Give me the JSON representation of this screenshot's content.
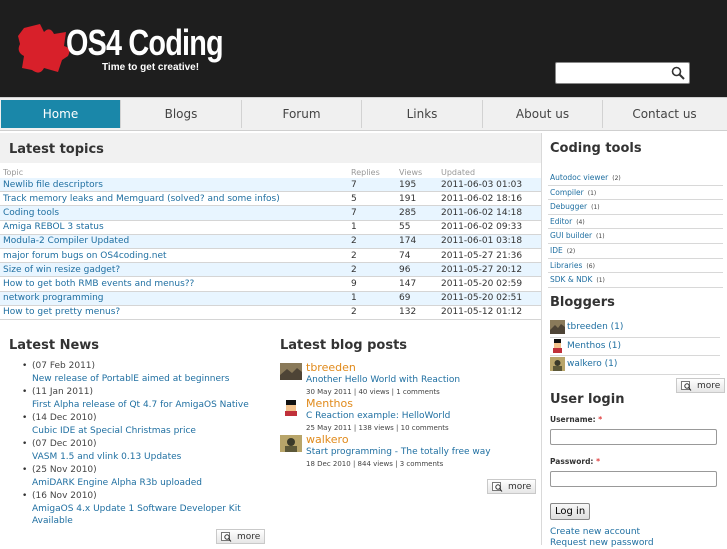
{
  "brand": {
    "name": "OS4 Coding",
    "slogan": "Time to get creative!"
  },
  "search": {
    "value": "",
    "placeholder": ""
  },
  "nav": [
    {
      "label": "Home"
    },
    {
      "label": "Blogs"
    },
    {
      "label": "Forum"
    },
    {
      "label": "Links"
    },
    {
      "label": "About us"
    },
    {
      "label": "Contact us"
    }
  ],
  "topics": {
    "title": "Latest topics",
    "headers": {
      "topic": "Topic",
      "replies": "Replies",
      "views": "Views",
      "updated": "Updated"
    },
    "rows": [
      {
        "topic": "Newlib file descriptors",
        "replies": "7",
        "views": "195",
        "updated": "2011-06-03 01:03"
      },
      {
        "topic": "Track memory leaks and Memguard (solved? and some infos)",
        "replies": "5",
        "views": "191",
        "updated": "2011-06-02 18:16"
      },
      {
        "topic": "Coding tools",
        "replies": "7",
        "views": "285",
        "updated": "2011-06-02 14:18"
      },
      {
        "topic": "Amiga REBOL 3 status",
        "replies": "1",
        "views": "55",
        "updated": "2011-06-02 09:33"
      },
      {
        "topic": "Modula-2 Compiler Updated",
        "replies": "2",
        "views": "174",
        "updated": "2011-06-01 03:18"
      },
      {
        "topic": "major forum bugs on OS4coding.net",
        "replies": "2",
        "views": "74",
        "updated": "2011-05-27 21:36"
      },
      {
        "topic": "Size of win resize gadget?",
        "replies": "2",
        "views": "96",
        "updated": "2011-05-27 20:12"
      },
      {
        "topic": "How to get both RMB events and menus??",
        "replies": "9",
        "views": "147",
        "updated": "2011-05-20 02:59"
      },
      {
        "topic": "network programming",
        "replies": "1",
        "views": "69",
        "updated": "2011-05-20 02:51"
      },
      {
        "topic": "How to get pretty menus?",
        "replies": "2",
        "views": "132",
        "updated": "2011-05-12 01:12"
      }
    ]
  },
  "news": {
    "title": "Latest News",
    "items": [
      {
        "date": "(07 Feb 2011)",
        "link": "New release of PortablE aimed at beginners"
      },
      {
        "date": "(11 Jan 2011)",
        "link": "First Alpha release of Qt 4.7 for AmigaOS Native"
      },
      {
        "date": "(14 Dec 2010)",
        "link": "Cubic IDE at Special Christmas price"
      },
      {
        "date": "(07 Dec 2010)",
        "link": "VASM 1.5 and vlink 0.13 Updates"
      },
      {
        "date": "(25 Nov 2010)",
        "link": "AmiDARK Engine Alpha R3b uploaded"
      },
      {
        "date": "(16 Nov 2010)",
        "link": "AmigaOS 4.x Update 1 Software Developer Kit Available"
      }
    ],
    "more": "more"
  },
  "blog": {
    "title": "Latest blog posts",
    "posts": [
      {
        "author": "tbreeden",
        "title": "Another Hello World with Reaction",
        "date": "30 May 2011",
        "views": "40 views",
        "comments": "1 comments"
      },
      {
        "author": "Menthos",
        "title": "C Reaction example: HelloWorld",
        "date": "25 May 2011",
        "views": "138 views",
        "comments": "10 comments"
      },
      {
        "author": "walkero",
        "title": "Start programming - The totally free way",
        "date": "18 Dec 2010",
        "views": "844 views",
        "comments": "3 comments"
      }
    ],
    "more": "more"
  },
  "sidebar": {
    "tools_title": "Coding tools",
    "tools": [
      {
        "label": "Autodoc viewer",
        "count": "(2)"
      },
      {
        "label": "Compiler",
        "count": "(1)"
      },
      {
        "label": "Debugger",
        "count": "(1)"
      },
      {
        "label": "Editor",
        "count": "(4)"
      },
      {
        "label": "GUI builder",
        "count": "(1)"
      },
      {
        "label": "IDE",
        "count": "(2)"
      },
      {
        "label": "Libraries",
        "count": "(6)"
      },
      {
        "label": "SDK & NDK",
        "count": "(1)"
      }
    ],
    "bloggers_title": "Bloggers",
    "bloggers": [
      {
        "label": "tbreeden (1)"
      },
      {
        "label": "Menthos (1)"
      },
      {
        "label": "walkero (1)"
      }
    ],
    "bloggers_more": "more",
    "login": {
      "title": "User login",
      "username_label": "Username:",
      "password_label": "Password:",
      "required": "*",
      "button": "Log in",
      "create": "Create new account",
      "request": "Request new password"
    }
  },
  "colors": {
    "accent": "#1a87a9",
    "link": "#1f6fa1",
    "author": "#e08a1b",
    "header_bg": "#1e1e1e",
    "logo_red": "#d8202a"
  }
}
